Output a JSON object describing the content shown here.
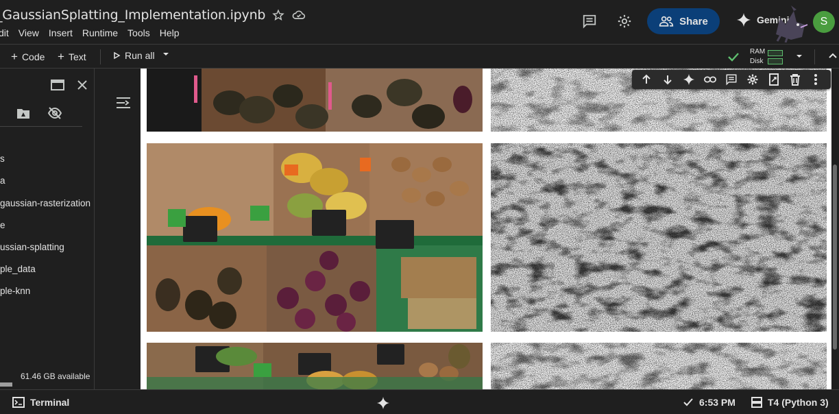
{
  "header": {
    "title": "_GaussianSplatting_Implementation.ipynb",
    "menu": [
      "dit",
      "View",
      "Insert",
      "Runtime",
      "Tools",
      "Help"
    ],
    "share_label": "Share",
    "gemini_label": "Gemini",
    "avatar_initial": "S"
  },
  "toolbar": {
    "code_label": "Code",
    "text_label": "Text",
    "run_all_label": "Run all",
    "ram_label": "RAM",
    "disk_label": "Disk"
  },
  "files": {
    "items": [
      "s",
      "a",
      "gaussian-rasterization",
      "e",
      "ussian-splatting",
      "ple_data",
      "ple-knn"
    ],
    "storage_text": "61.46 GB available"
  },
  "statusbar": {
    "terminal_label": "Terminal",
    "time": "6:53 PM",
    "runtime": "T4 (Python 3)"
  },
  "colors": {
    "accent_share": "#0b3f78",
    "status_green": "#5fbf6f",
    "avatar_bg": "#4a9d3f"
  }
}
